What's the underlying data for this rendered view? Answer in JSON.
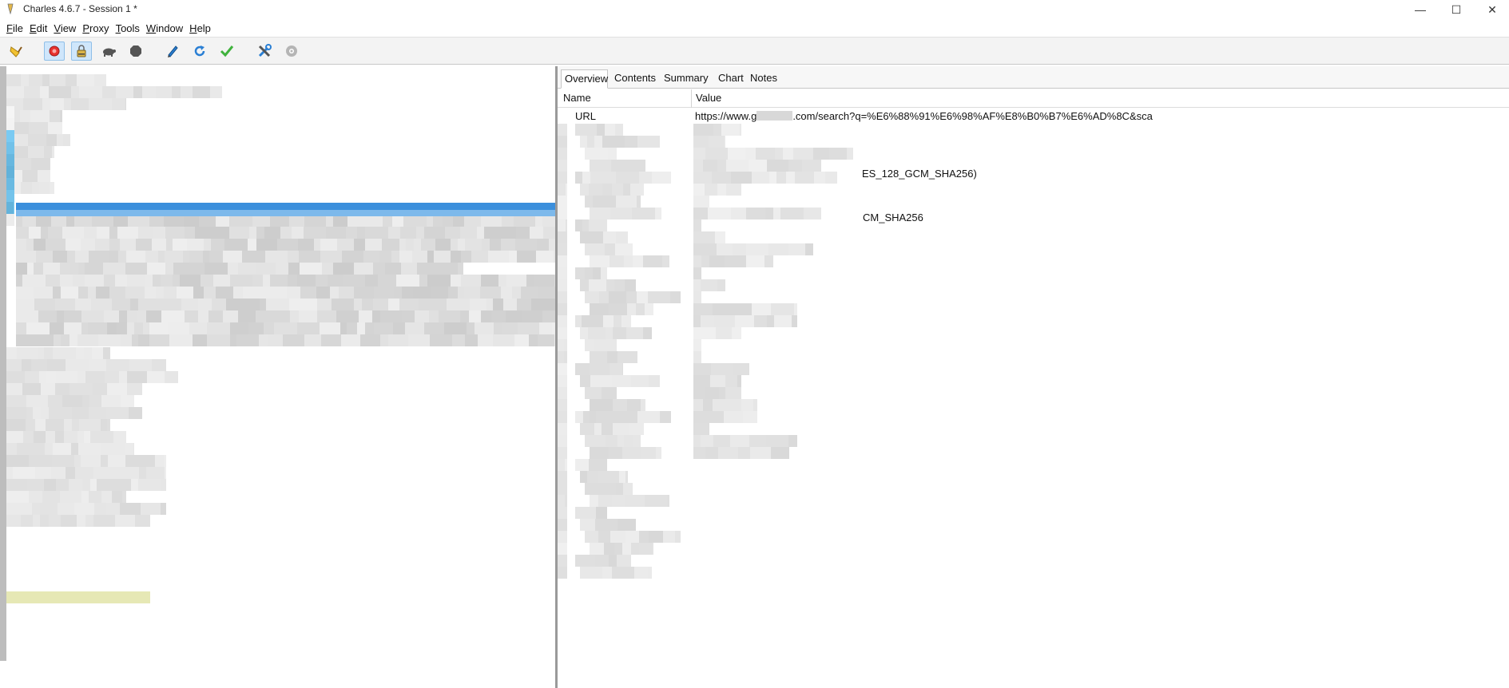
{
  "window": {
    "title": "Charles 4.6.7 - Session 1 *",
    "minimize_glyph": "—",
    "maximize_glyph": "☐",
    "close_glyph": "✕"
  },
  "menu": [
    {
      "mnemonic": "F",
      "rest": "ile"
    },
    {
      "mnemonic": "E",
      "rest": "dit"
    },
    {
      "mnemonic": "V",
      "rest": "iew"
    },
    {
      "mnemonic": "P",
      "rest": "roxy"
    },
    {
      "mnemonic": "T",
      "rest": "ools"
    },
    {
      "mnemonic": "W",
      "rest": "indow"
    },
    {
      "mnemonic": "H",
      "rest": "elp"
    }
  ],
  "toolbar": {
    "icons": [
      "broom-icon",
      "record-icon",
      "ssl-proxy-icon",
      "throttle-icon",
      "breakpoints-icon",
      "compose-icon",
      "repeat-icon",
      "validate-icon",
      "tools-icon",
      "settings-icon"
    ],
    "colors": {
      "record": "#e8322f",
      "repeat": "#2a7fd4",
      "validate": "#3fb23c",
      "active_bg": "#cfe6fb"
    }
  },
  "detail": {
    "tabs": [
      "Overview",
      "Contents",
      "Summary",
      "Chart",
      "Notes"
    ],
    "active_tab": "Overview",
    "columns": {
      "name": "Name",
      "value": "Value"
    },
    "url_row": {
      "name": "URL",
      "value_part1": "https://www.g",
      "value_part2": ".com/search?q=%E6%88%91%E6%98%AF%E8%B0%B7%E6%AD%8C&sca"
    },
    "partial_values": [
      "ES_128_GCM_SHA256)",
      "CM_SHA256"
    ]
  },
  "colors": {
    "selection": "#3b8fdc",
    "selection_light": "#8fc3ef",
    "highlight_row": "#e6e8b5",
    "splitter": "#9a9a9a"
  }
}
